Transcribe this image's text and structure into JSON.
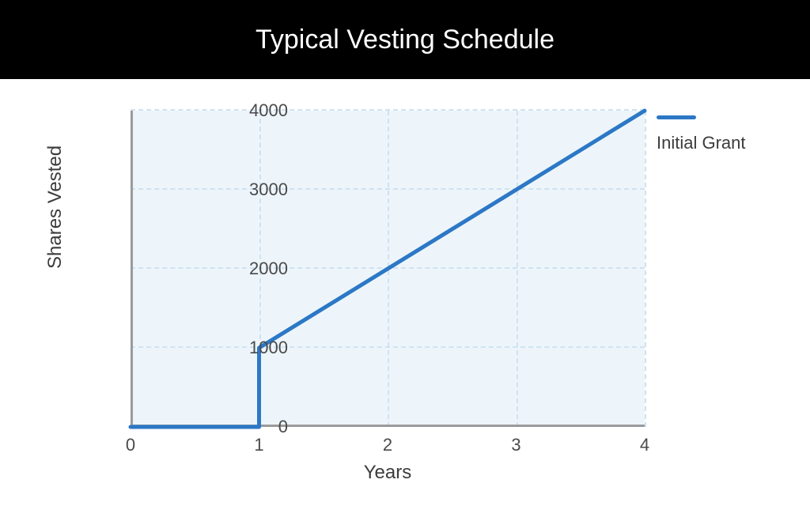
{
  "header": {
    "title": "Typical Vesting Schedule"
  },
  "ylabel": "Shares Vested",
  "xlabel": "Years",
  "legend": {
    "label": "Initial Grant"
  },
  "yticks": [
    "0",
    "1000",
    "2000",
    "3000",
    "4000"
  ],
  "xticks": [
    "0",
    "1",
    "2",
    "3",
    "4"
  ],
  "chart_data": {
    "type": "line",
    "title": "Typical Vesting Schedule",
    "xlabel": "Years",
    "ylabel": "Shares Vested",
    "xlim": [
      0,
      4
    ],
    "ylim": [
      0,
      4000
    ],
    "series": [
      {
        "name": "Initial Grant",
        "x": [
          0,
          1,
          1,
          2,
          3,
          4
        ],
        "y": [
          0,
          0,
          1000,
          2000,
          3000,
          4000
        ]
      }
    ]
  }
}
